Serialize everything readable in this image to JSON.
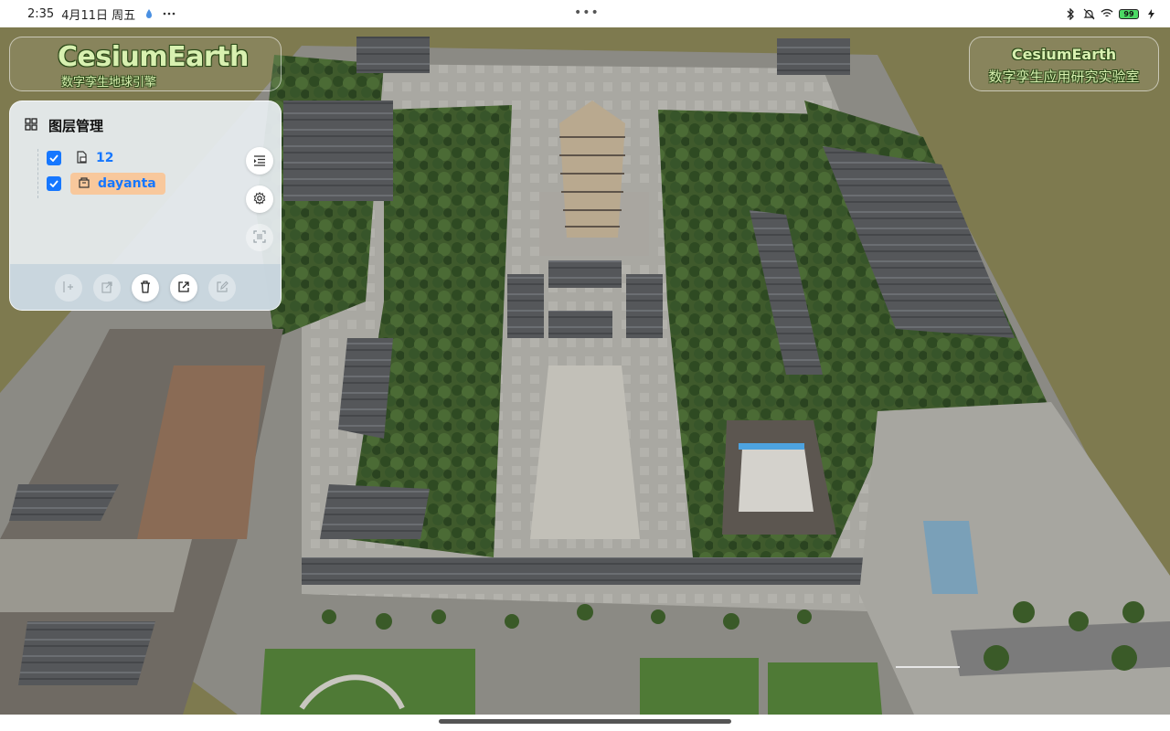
{
  "status_bar": {
    "time": "2:35",
    "date": "4月11日 周五",
    "more_dots": "•••",
    "battery_level": "99",
    "icons": [
      "drop-icon",
      "more-icon",
      "bluetooth-icon",
      "mute-icon",
      "wifi-icon",
      "battery-icon",
      "charging-icon"
    ]
  },
  "logo_left": {
    "title": "CesiumEarth",
    "subtitle": "数字孪生地球引擎"
  },
  "logo_right": {
    "title": "CesiumEarth",
    "subtitle": "数字孪生应用研究实验室"
  },
  "layer_panel": {
    "title": "图层管理",
    "layers": [
      {
        "label": "12",
        "checked": true,
        "icon": "tileset-icon",
        "selected": false
      },
      {
        "label": "dayanta",
        "checked": true,
        "icon": "model-icon",
        "selected": true
      }
    ],
    "side_buttons": [
      "list-indent-icon",
      "gear-icon",
      "fit-view-icon"
    ],
    "footer_buttons": [
      "add-layer-icon",
      "import-icon",
      "trash-icon",
      "export-icon",
      "edit-icon"
    ]
  },
  "colors": {
    "accent": "#1677ff",
    "selected_chip": "#f8c89c",
    "logo_text": "#d8f0b0",
    "logo_outline": "#2b4a18",
    "terrain": "#7e7a4f"
  }
}
